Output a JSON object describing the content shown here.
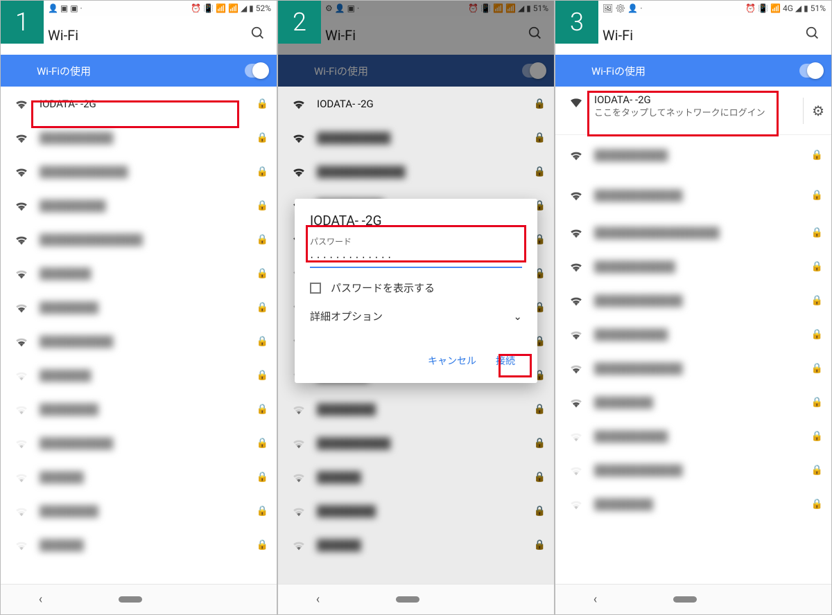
{
  "screens": [
    {
      "step": "1",
      "status": {
        "left_icons": "👤 ▣ ▣  ·",
        "right_text": "⏰ 📳 📶 📶 ◢ ▮ 52%"
      },
      "title": "Wi-Fi",
      "toggle_label": "Wi-Fiの使用",
      "networks": [
        {
          "ssid": "IODATA-            -2G",
          "lock": true,
          "strength": "strong",
          "highlight": true
        },
        {
          "ssid": "██████████",
          "blur": true,
          "lock": true,
          "strength": "strong"
        },
        {
          "ssid": "████████████",
          "blur": true,
          "lock": true,
          "strength": "strong"
        },
        {
          "ssid": "█████████",
          "blur": true,
          "lock": true,
          "strength": "strong"
        },
        {
          "ssid": "██████████████",
          "blur": true,
          "lock": true,
          "strength": "strong"
        },
        {
          "ssid": "███████",
          "blur": true,
          "lock": true,
          "strength": "mid"
        },
        {
          "ssid": "████████",
          "blur": true,
          "lock": true,
          "strength": "mid"
        },
        {
          "ssid": "██████████",
          "blur": true,
          "lock": true,
          "strength": "mid"
        },
        {
          "ssid": "███████",
          "blur": true,
          "lock": true,
          "strength": "weak"
        },
        {
          "ssid": "████████",
          "blur": true,
          "lock": true,
          "strength": "weak"
        },
        {
          "ssid": "██████████",
          "blur": true,
          "lock": true,
          "strength": "weak"
        },
        {
          "ssid": "██████",
          "blur": true,
          "lock": true,
          "strength": "weak"
        },
        {
          "ssid": "████████",
          "blur": true,
          "lock": true,
          "strength": "weak"
        },
        {
          "ssid": "██████",
          "blur": true,
          "lock": true,
          "strength": "weak"
        }
      ]
    },
    {
      "step": "2",
      "status": {
        "left_icons": "⚙ 👤 ▣  ·",
        "right_text": "⏰ 📳 📶 📶 ◢ ▮ 51%"
      },
      "title": "Wi-Fi",
      "toggle_label": "Wi-Fiの使用",
      "networks": [
        {
          "ssid": "IODATA-            -2G",
          "lock": true,
          "strength": "strong"
        },
        {
          "ssid": "██████████",
          "blur": true,
          "lock": true,
          "strength": "strong"
        },
        {
          "ssid": "████████████",
          "blur": true,
          "lock": true,
          "strength": "strong"
        },
        {
          "ssid": "█████████",
          "blur": true,
          "lock": true,
          "strength": "strong"
        },
        {
          "ssid": "██████████████",
          "blur": true,
          "lock": true,
          "strength": "strong"
        },
        {
          "ssid": "███████",
          "blur": true,
          "lock": true,
          "strength": "mid"
        },
        {
          "ssid": "████████",
          "blur": true,
          "lock": true,
          "strength": "mid"
        },
        {
          "ssid": "██████████",
          "blur": true,
          "lock": true,
          "strength": "mid"
        },
        {
          "ssid": "███████",
          "blur": true,
          "lock": true,
          "strength": "weak"
        },
        {
          "ssid": "████████",
          "blur": true,
          "lock": true,
          "strength": "weak"
        },
        {
          "ssid": "██████████",
          "blur": true,
          "lock": true,
          "strength": "weak"
        },
        {
          "ssid": "██████",
          "blur": true,
          "lock": true,
          "strength": "weak"
        },
        {
          "ssid": "████████",
          "blur": true,
          "lock": true,
          "strength": "weak"
        },
        {
          "ssid": "██████",
          "blur": true,
          "lock": true,
          "strength": "weak"
        }
      ],
      "dialog": {
        "title": "IODATA-           -2G",
        "password_label": "パスワード",
        "password_value": "·············",
        "show_password": "パスワードを表示する",
        "advanced": "詳細オプション",
        "cancel": "キャンセル",
        "connect": "接続"
      }
    },
    {
      "step": "3",
      "status": {
        "left_icons": "🖼 ⚙ 👤  ·",
        "right_text": "⏰ 📳 📶 4G ◢ ▮ 51%"
      },
      "title": "Wi-Fi",
      "toggle_label": "Wi-Fiの使用",
      "connected": {
        "ssid": "IODATA-            -2G",
        "sub": "ここをタップしてネットワークにログイン"
      },
      "networks": [
        {
          "ssid": "██████████",
          "blur": true,
          "lock": true,
          "strength": "strong",
          "tall": true
        },
        {
          "ssid": "████████████",
          "blur": true,
          "lock": true,
          "strength": "strong",
          "tall": true
        },
        {
          "ssid": "█████████████████",
          "blur": true,
          "lock": true,
          "strength": "strong"
        },
        {
          "ssid": "███████████",
          "blur": true,
          "lock": true,
          "strength": "strong"
        },
        {
          "ssid": "████████████",
          "blur": true,
          "lock": true,
          "strength": "strong"
        },
        {
          "ssid": "██████████",
          "blur": true,
          "lock": true,
          "strength": "mid"
        },
        {
          "ssid": "████████████",
          "blur": true,
          "lock": true,
          "strength": "mid"
        },
        {
          "ssid": "████████",
          "blur": true,
          "lock": true,
          "strength": "mid"
        },
        {
          "ssid": "██████████",
          "blur": true,
          "lock": true,
          "strength": "weak"
        },
        {
          "ssid": "████████████",
          "blur": true,
          "lock": true,
          "strength": "weak"
        },
        {
          "ssid": "████████",
          "blur": true,
          "lock": true,
          "strength": "weak"
        }
      ]
    }
  ]
}
